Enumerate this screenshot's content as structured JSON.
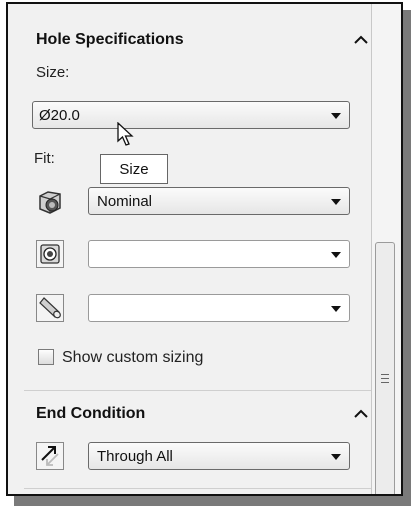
{
  "hole_specifications": {
    "title": "Hole Specifications",
    "size_label": "Size:",
    "size_value": "Ø20.0",
    "fit_label": "Fit:",
    "fit_value": "Nominal",
    "show_custom_sizing_label": "Show custom sizing",
    "show_custom_sizing_checked": false
  },
  "tooltip": {
    "text": "Size"
  },
  "end_condition": {
    "title": "End Condition",
    "value": "Through All"
  },
  "icons": [
    "chevron-up-icon",
    "fit-cylinder-icon",
    "face-hole-icon",
    "pin-cylinder-icon",
    "end-direction-icon",
    "scroll-grip-icon",
    "mouse-cursor-icon"
  ]
}
